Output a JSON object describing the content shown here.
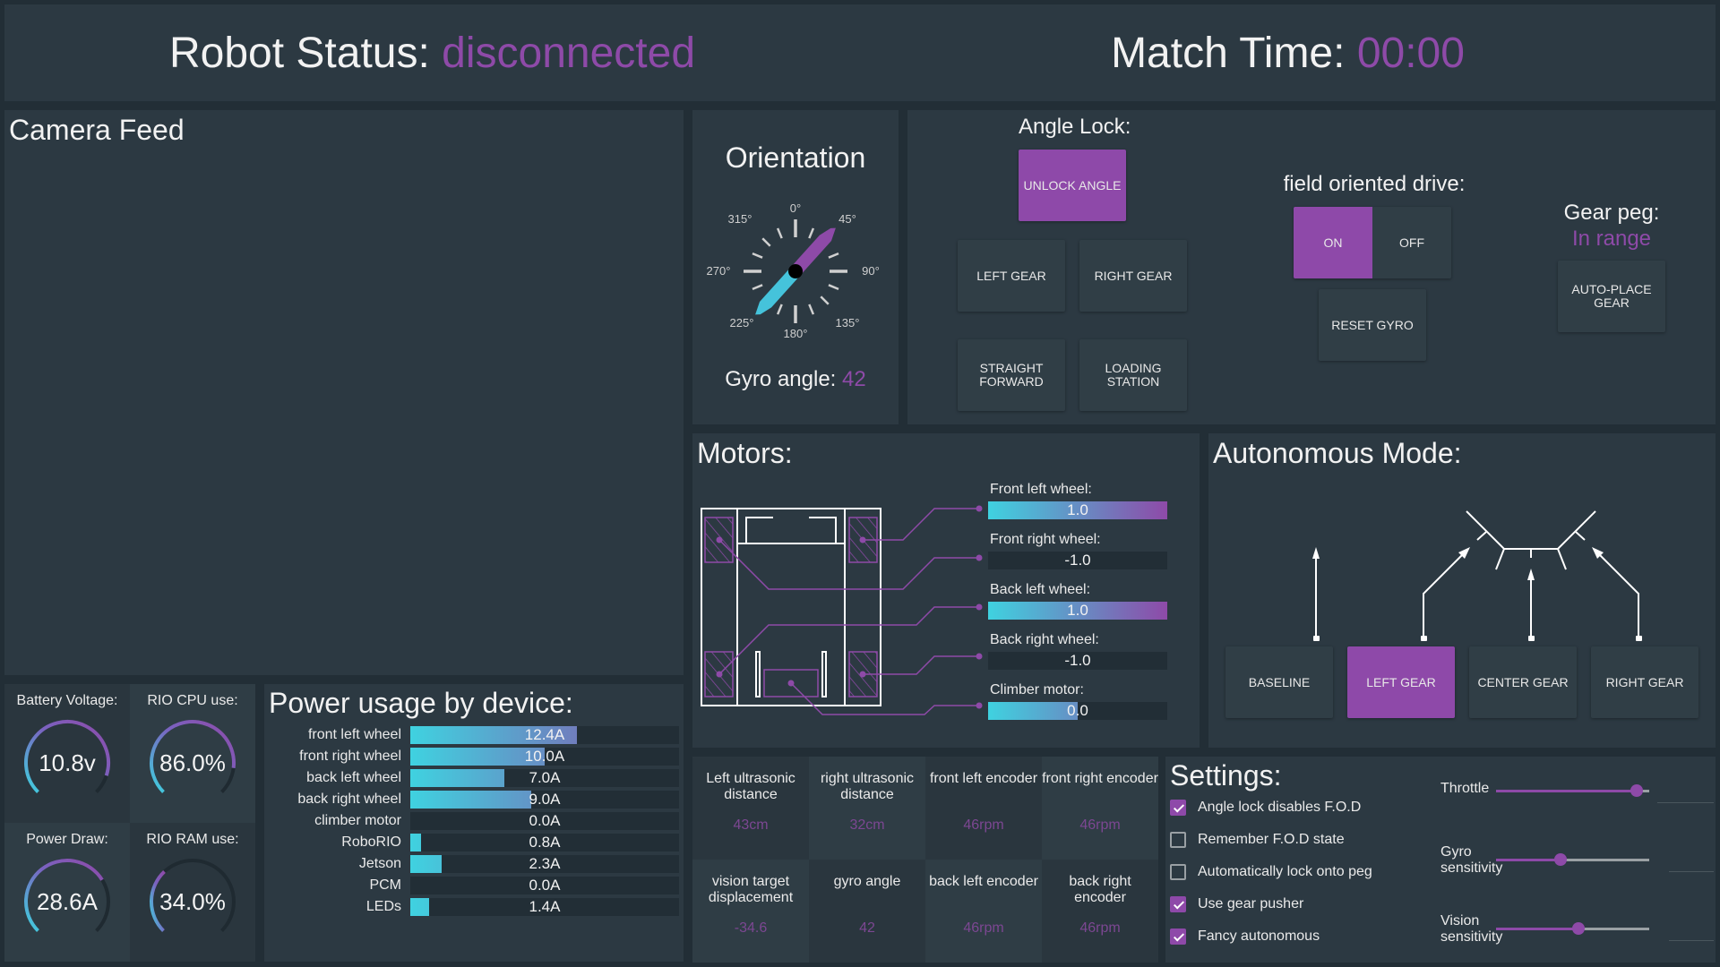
{
  "header": {
    "robot_status_label": "Robot Status:",
    "robot_status_value": "disconnected",
    "match_time_label": "Match Time:",
    "match_time_value": "00:00"
  },
  "camera": {
    "title": "Camera Feed"
  },
  "orientation": {
    "title": "Orientation",
    "tick_labels": [
      "0°",
      "45°",
      "90°",
      "135°",
      "180°",
      "225°",
      "270°",
      "315°"
    ],
    "gyro_label": "Gyro angle:",
    "gyro_value": "42",
    "heading_deg": 42
  },
  "controls": {
    "angle_lock_label": "Angle Lock:",
    "unlock_angle": "UNLOCK ANGLE",
    "left_gear": "LEFT GEAR",
    "right_gear": "RIGHT GEAR",
    "straight_forward": "STRAIGHT\nFORWARD",
    "loading_station": "LOADING\nSTATION",
    "fod_label": "field oriented drive:",
    "fod_on": "ON",
    "fod_off": "OFF",
    "fod_state": "ON",
    "reset_gyro": "RESET GYRO",
    "gear_peg_label": "Gear peg:",
    "gear_peg_value": "In range",
    "auto_place_gear": "AUTO-PLACE\nGEAR"
  },
  "gauges": [
    {
      "label": "Battery Voltage:",
      "value": "10.8v",
      "fraction": 0.9
    },
    {
      "label": "RIO CPU use:",
      "value": "86.0%",
      "fraction": 0.86
    },
    {
      "label": "Power Draw:",
      "value": "28.6A",
      "fraction": 0.715
    },
    {
      "label": "RIO RAM use:",
      "value": "34.0%",
      "fraction": 0.34
    }
  ],
  "power": {
    "title": "Power usage by device:",
    "max_amps": 20,
    "devices": [
      {
        "name": "front left wheel",
        "amps": 12.4,
        "label": "12.4A"
      },
      {
        "name": "front right wheel",
        "amps": 10.0,
        "label": "10.0A"
      },
      {
        "name": "back left wheel",
        "amps": 7.0,
        "label": "7.0A"
      },
      {
        "name": "back right wheel",
        "amps": 9.0,
        "label": "9.0A"
      },
      {
        "name": "climber motor",
        "amps": 0.0,
        "label": "0.0A"
      },
      {
        "name": "RoboRIO",
        "amps": 0.8,
        "label": "0.8A"
      },
      {
        "name": "Jetson",
        "amps": 2.3,
        "label": "2.3A"
      },
      {
        "name": "PCM",
        "amps": 0.0,
        "label": "0.0A"
      },
      {
        "name": "LEDs",
        "amps": 1.4,
        "label": "1.4A"
      }
    ]
  },
  "motors": {
    "title": "Motors:",
    "items": [
      {
        "label": "Front left wheel:",
        "value": 1.0,
        "text": "1.0"
      },
      {
        "label": "Front right wheel:",
        "value": -1.0,
        "text": "-1.0"
      },
      {
        "label": "Back left wheel:",
        "value": 1.0,
        "text": "1.0"
      },
      {
        "label": "Back right wheel:",
        "value": -1.0,
        "text": "-1.0"
      },
      {
        "label": "Climber motor:",
        "value": 0.0,
        "text": "0.0"
      }
    ]
  },
  "autonomous": {
    "title": "Autonomous Mode:",
    "modes": [
      "BASELINE",
      "LEFT GEAR",
      "CENTER GEAR",
      "RIGHT GEAR"
    ],
    "selected": "LEFT GEAR"
  },
  "sensors": [
    {
      "label": "Left ultrasonic distance",
      "value": "43cm"
    },
    {
      "label": "right ultrasonic distance",
      "value": "32cm"
    },
    {
      "label": "front left encoder",
      "value": "46rpm"
    },
    {
      "label": "front right encoder",
      "value": "46rpm"
    },
    {
      "label": "vision target displacement",
      "value": "-34.6"
    },
    {
      "label": "gyro angle",
      "value": "42"
    },
    {
      "label": "back left encoder",
      "value": "46rpm"
    },
    {
      "label": "back right encoder",
      "value": "46rpm"
    }
  ],
  "settings": {
    "title": "Settings:",
    "checkboxes": [
      {
        "label": "Angle lock disables F.O.D",
        "checked": true
      },
      {
        "label": "Remember F.O.D state",
        "checked": false
      },
      {
        "label": "Automatically lock onto peg",
        "checked": false
      },
      {
        "label": "Use gear pusher",
        "checked": true
      },
      {
        "label": "Fancy autonomous",
        "checked": true
      }
    ],
    "sliders": [
      {
        "label": "Throttle",
        "fraction": 0.92
      },
      {
        "label": "Gyro\nsensitivity",
        "fraction": 0.42
      },
      {
        "label": "Vision\nsensitivity",
        "fraction": 0.54
      }
    ]
  },
  "colors": {
    "accent": "#8e4aa8",
    "cyan": "#3fd2e0",
    "panel": "#2c3942",
    "background": "#222e36"
  }
}
